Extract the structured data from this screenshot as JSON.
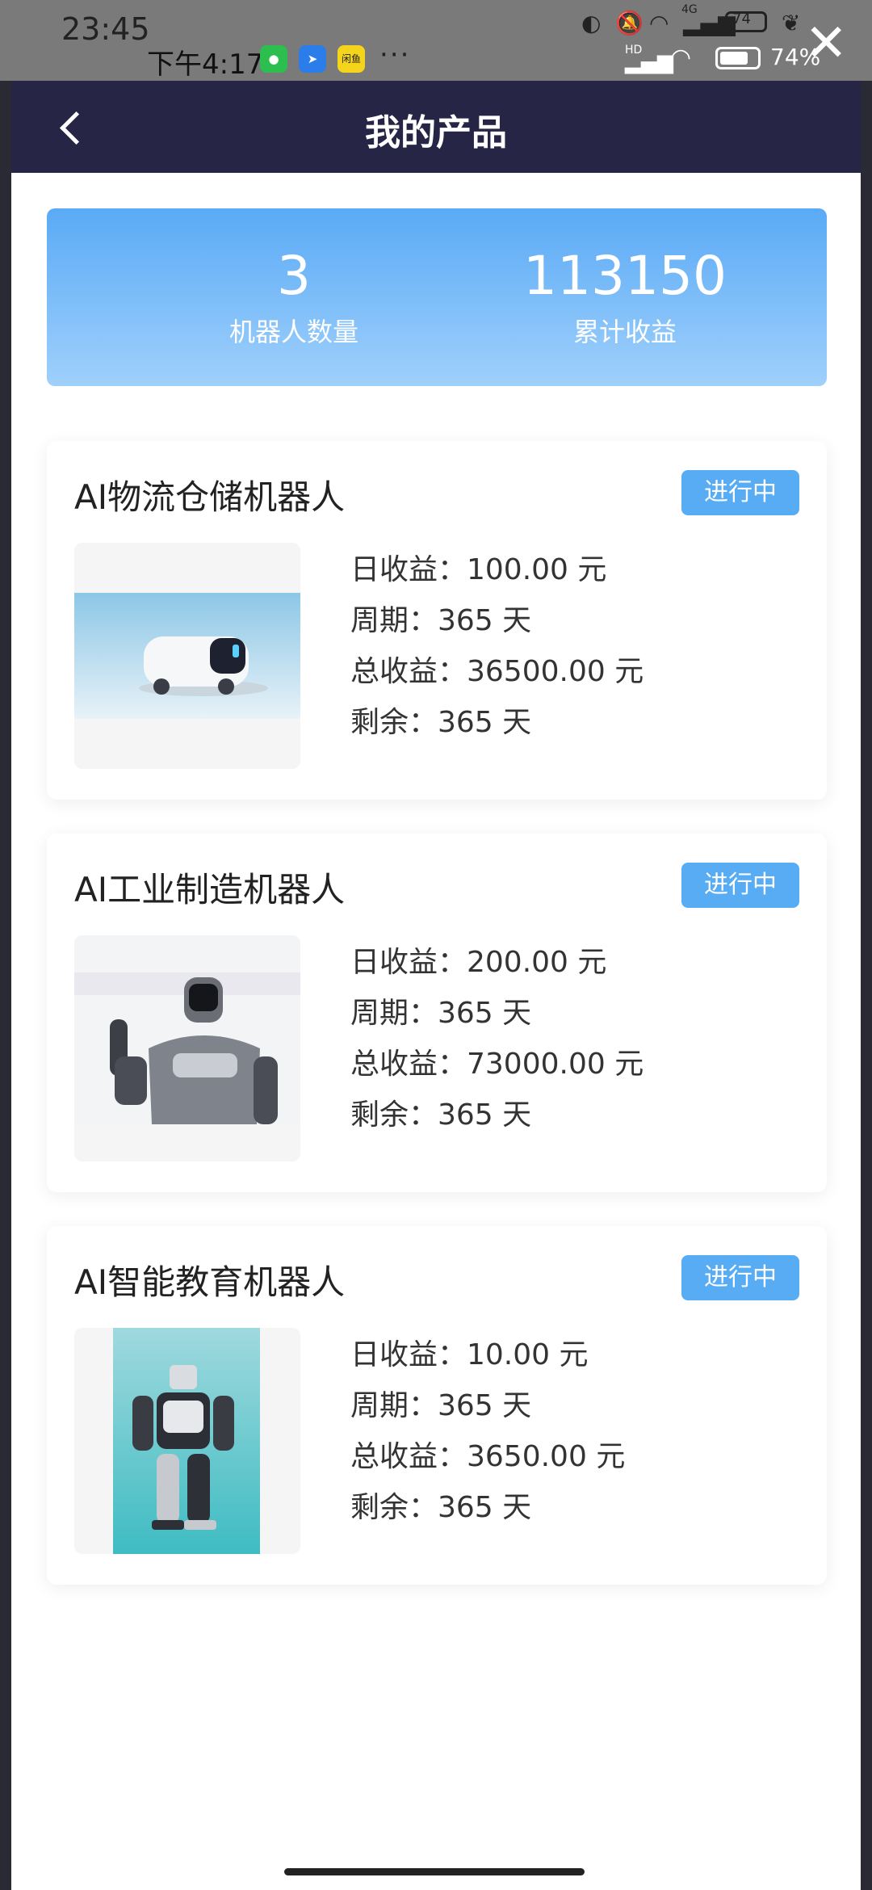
{
  "status_outer": {
    "time": "23:45",
    "net_badge": "4G",
    "battery": "74"
  },
  "status_inner": {
    "time": "下午4:17",
    "app3_label": "闲鱼",
    "more": "···",
    "hd": "HD",
    "battery": "74%"
  },
  "header": {
    "title": "我的产品"
  },
  "summary": {
    "count_value": "3",
    "count_label": "机器人数量",
    "income_value": "113150",
    "income_label": "累计收益"
  },
  "products": [
    {
      "name": "AI物流仓储机器人",
      "status": "进行中",
      "daily": "日收益：100.00 元",
      "period": "周期：365 天",
      "total": "总收益：36500.00 元",
      "remain": "剩余：365 天"
    },
    {
      "name": "AI工业制造机器人",
      "status": "进行中",
      "daily": "日收益：200.00 元",
      "period": "周期：365 天",
      "total": "总收益：73000.00 元",
      "remain": "剩余：365 天"
    },
    {
      "name": "AI智能教育机器人",
      "status": "进行中",
      "daily": "日收益：10.00 元",
      "period": "周期：365 天",
      "total": "总收益：3650.00 元",
      "remain": "剩余：365 天"
    }
  ],
  "colors": {
    "header_bg": "#272546",
    "accent": "#58acf4"
  }
}
